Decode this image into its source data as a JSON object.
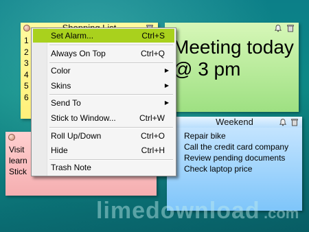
{
  "notes": {
    "shopping": {
      "title": "Shopping List",
      "items": [
        "1",
        "2",
        "3",
        "4",
        "5",
        "6"
      ]
    },
    "meeting": {
      "lines": [
        "Meeting today",
        "@ 3 pm"
      ]
    },
    "visit": {
      "lines": [
        "Visit",
        "learn",
        "Stick"
      ]
    },
    "weekend": {
      "title": "Weekend",
      "lines": [
        "Repair bike",
        "Call the credit card company",
        "Review pending documents",
        "Check laptop price"
      ]
    }
  },
  "menu": {
    "set_alarm": {
      "label": "Set Alarm...",
      "shortcut": "Ctrl+S"
    },
    "always_on_top": {
      "label": "Always On Top",
      "shortcut": "Ctrl+Q"
    },
    "color": {
      "label": "Color"
    },
    "skins": {
      "label": "Skins"
    },
    "send_to": {
      "label": "Send To"
    },
    "stick_to_window": {
      "label": "Stick to Window...",
      "shortcut": "Ctrl+W"
    },
    "roll_up_down": {
      "label": "Roll Up/Down",
      "shortcut": "Ctrl+O"
    },
    "hide": {
      "label": "Hide",
      "shortcut": "Ctrl+H"
    },
    "trash_note": {
      "label": "Trash Note"
    }
  },
  "colors": {
    "highlight": "#a9d11d",
    "yellow_note": "#fff07a",
    "green_note": "#9ee082",
    "pink_note": "#f5aeb0",
    "blue_note": "#7ec5fa"
  },
  "watermark": {
    "brand": "limedownload",
    "domain": ".com"
  },
  "icons": [
    "bell-icon",
    "trash-icon",
    "note-dot-icon",
    "submenu-arrow-icon"
  ]
}
